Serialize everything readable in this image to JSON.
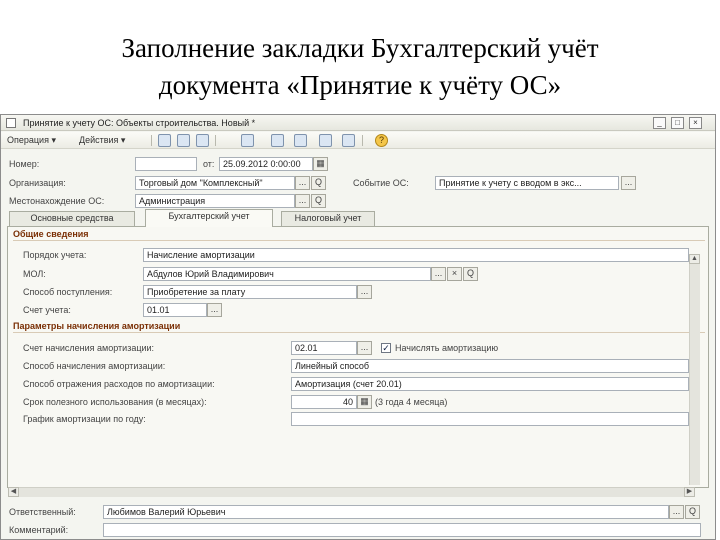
{
  "slide": {
    "title_line1": "Заполнение закладки Бухгалтерский учёт",
    "title_line2": "документа «Принятие к учёту ОС»"
  },
  "window": {
    "title": "Принятие к учету ОС: Объекты строительства. Новый *",
    "controls": {
      "minimize": "_",
      "maximize": "□",
      "close": "×"
    }
  },
  "toolbar": {
    "operation_menu": "Операция ▾",
    "actions_menu": "Действия ▾",
    "icons": [
      "save-icon",
      "post-icon",
      "structure-icon",
      "dt-kt-icon",
      "print-icon",
      "help-icon"
    ],
    "help_label": "?"
  },
  "header": {
    "number_label": "Номер:",
    "number_value": "",
    "date_label": "от:",
    "date_value": "25.09.2012  0:00:00",
    "org_label": "Организация:",
    "org_value": "Торговый дом \"Комплексный\"",
    "event_label": "Событие ОС:",
    "event_value": "Принятие к учету с вводом в экс...",
    "location_label": "Местонахождение ОС:",
    "location_value": "Администрация",
    "dots": "...",
    "search": "Q",
    "calendar": "▦"
  },
  "tabs": [
    {
      "label": "Основные средства"
    },
    {
      "label": "Бухгалтерский учет"
    },
    {
      "label": "Налоговый учет"
    }
  ],
  "general": {
    "section_title": "Общие сведения",
    "accounting_order_label": "Порядок учета:",
    "accounting_order_value": "Начисление амортизации",
    "mol_label": "МОЛ:",
    "mol_value": "Абдулов Юрий Владимирович",
    "receipt_method_label": "Способ поступления:",
    "receipt_method_value": "Приобретение за плату",
    "account_label": "Счет учета:",
    "account_value": "01.01",
    "clear": "×"
  },
  "depreciation": {
    "section_title": "Параметры начисления амортизации",
    "depr_account_label": "Счет начисления амортизации:",
    "depr_account_value": "02.01",
    "accrue_checkbox_label": "Начислять амортизацию",
    "accrue_checked": "✓",
    "method_label": "Способ начисления амортизации:",
    "method_value": "Линейный способ",
    "expense_method_label": "Способ отражения расходов по амортизации:",
    "expense_method_value": "Амортизация (счет 20.01)",
    "useful_life_label": "Срок полезного использования (в месяцах):",
    "useful_life_value": "40",
    "useful_life_text": "(3 года 4 месяца)",
    "schedule_label": "График амортизации по году:",
    "schedule_value": ""
  },
  "footer": {
    "responsible_label": "Ответственный:",
    "responsible_value": "Любимов Валерий Юрьевич",
    "comment_label": "Комментарий:",
    "comment_value": ""
  }
}
